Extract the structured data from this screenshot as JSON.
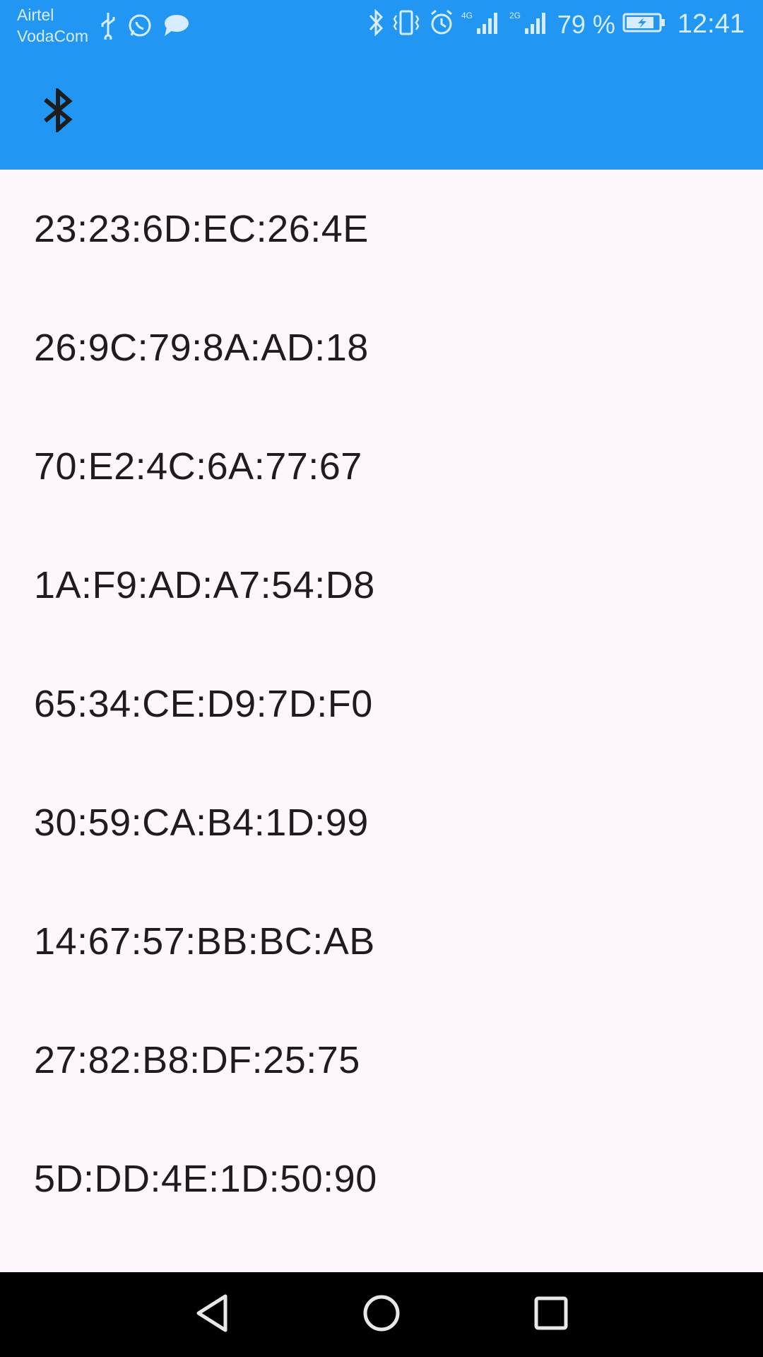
{
  "status_bar": {
    "carrier_1": "Airtel",
    "carrier_2": "VodaCom",
    "left_icons": [
      "usb-icon",
      "whatsapp-icon",
      "message-icon"
    ],
    "right_icons": [
      "bluetooth-icon",
      "vibrate-icon",
      "alarm-icon",
      "signal-4g-icon",
      "signal-2g-icon",
      "battery-charging-icon"
    ],
    "battery_percent": "79 %",
    "time": "12:41"
  },
  "app_bar": {
    "icon": "bluetooth-icon",
    "background_color": "#2196f3"
  },
  "devices": [
    {
      "address": "23:23:6D:EC:26:4E"
    },
    {
      "address": "26:9C:79:8A:AD:18"
    },
    {
      "address": "70:E2:4C:6A:77:67"
    },
    {
      "address": "1A:F9:AD:A7:54:D8"
    },
    {
      "address": "65:34:CE:D9:7D:F0"
    },
    {
      "address": "30:59:CA:B4:1D:99"
    },
    {
      "address": "14:67:57:BB:BC:AB"
    },
    {
      "address": "27:82:B8:DF:25:75"
    },
    {
      "address": "5D:DD:4E:1D:50:90"
    }
  ],
  "nav_bar": {
    "buttons": [
      "back-icon",
      "home-icon",
      "recents-icon"
    ]
  }
}
